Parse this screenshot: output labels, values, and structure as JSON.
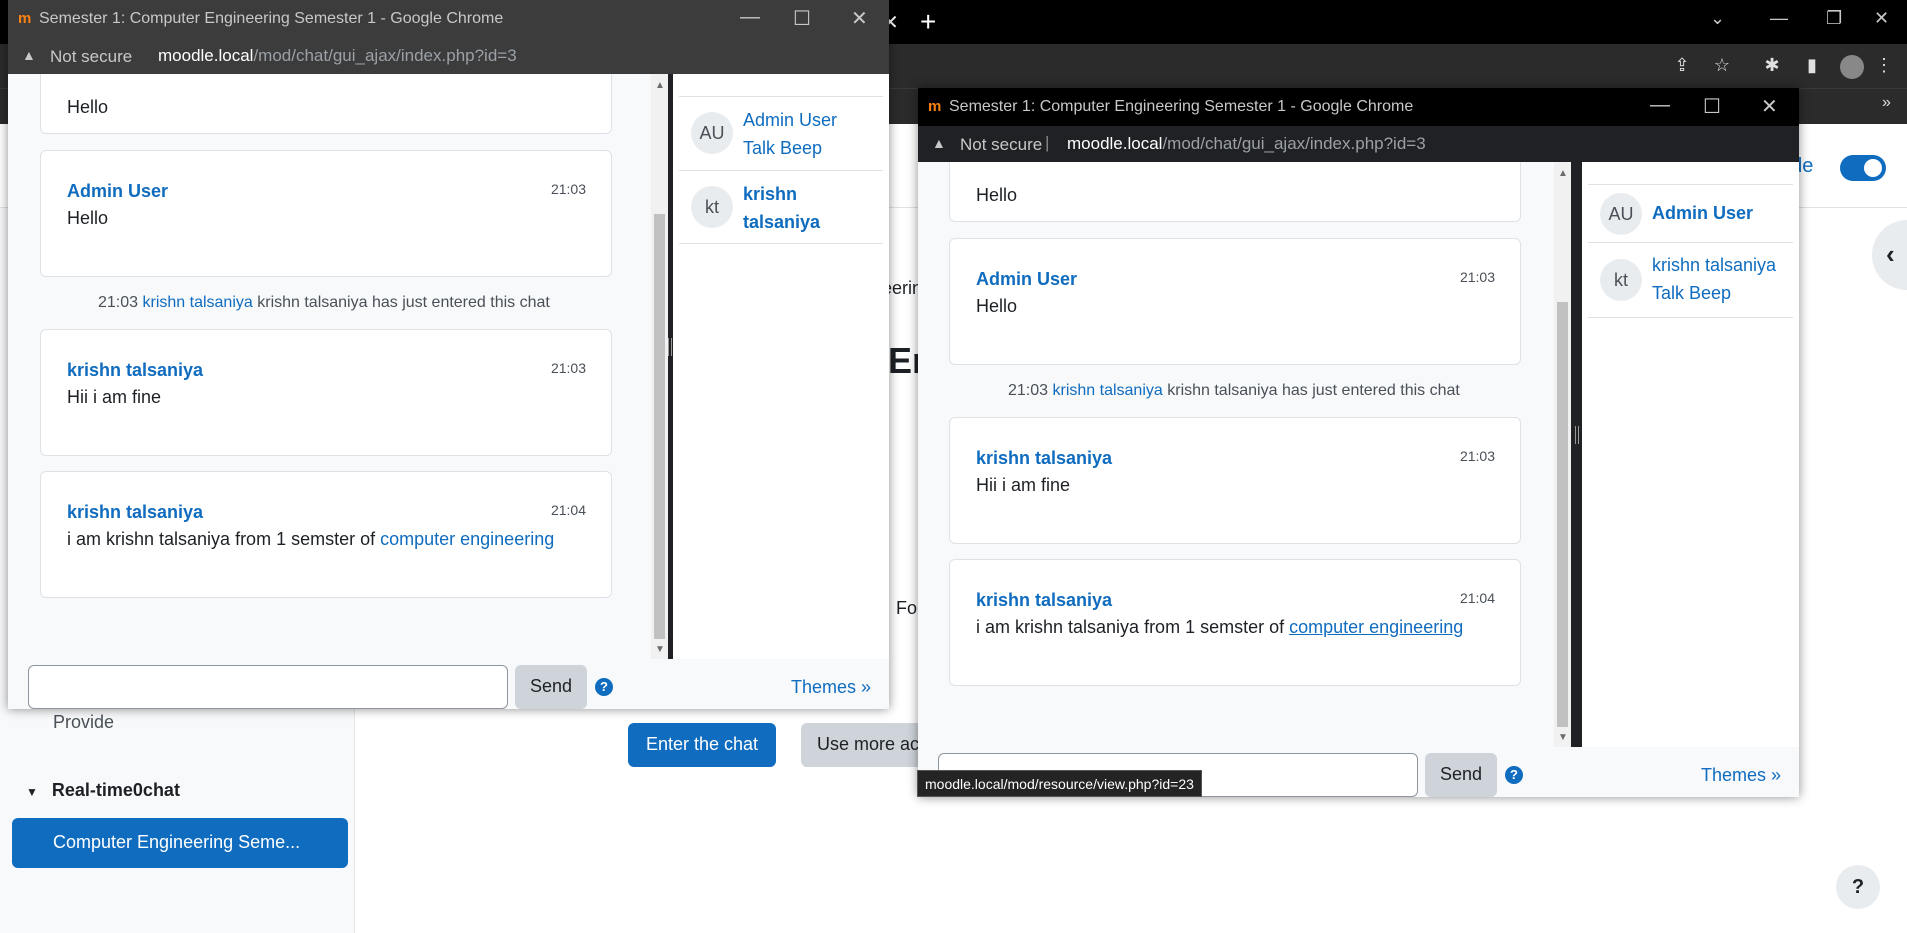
{
  "colors": {
    "accent": "#0f6cbf",
    "moodle_orange": "#f98012",
    "chrome_dark": "#202124"
  },
  "background": {
    "mode_label": "ode",
    "left_drawer": {
      "provide": "Provide",
      "section": "Real-time0chat",
      "active_item": "Computer Engineering Seme..."
    },
    "main": {
      "frag_1": "eerin",
      "frag_2": "En",
      "frag_3": "Fo",
      "enter_chat": "Enter the chat",
      "use_more": "Use more ac"
    },
    "help": "?"
  },
  "windows": {
    "title": "Semester 1: Computer Engineering Semester 1 - Google Chrome",
    "not_secure": "Not secure",
    "url_host": "moodle.local",
    "url_path": "/mod/chat/gui_ajax/index.php?id=3",
    "partial_hello": "Hello",
    "messages": [
      {
        "author": "Admin User",
        "time": "21:03",
        "text": "Hello"
      },
      {
        "author": "krishn talsaniya",
        "time": "21:03",
        "text": "Hii i am fine"
      },
      {
        "author": "krishn talsaniya",
        "time": "21:04",
        "text_prefix": "i am krishn talsaniya from 1 semster of ",
        "link": "computer engineering"
      }
    ],
    "system_message": {
      "time": "21:03",
      "user_link": "krishn talsaniya",
      "text": "krishn talsaniya has just entered this chat"
    },
    "send": "Send",
    "themes": "Themes »"
  },
  "window_a_users": [
    {
      "initials": "AU",
      "line1": "Admin User",
      "line2": "Talk Beep"
    },
    {
      "initials": "kt",
      "line1": "krishn",
      "line2": "talsaniya"
    }
  ],
  "window_b_users": [
    {
      "initials": "AU",
      "line1": "Admin User"
    },
    {
      "initials": "kt",
      "line1": "krishn talsaniya",
      "line2": "Talk Beep"
    }
  ],
  "status_bar_url": "moodle.local/mod/resource/view.php?id=23"
}
